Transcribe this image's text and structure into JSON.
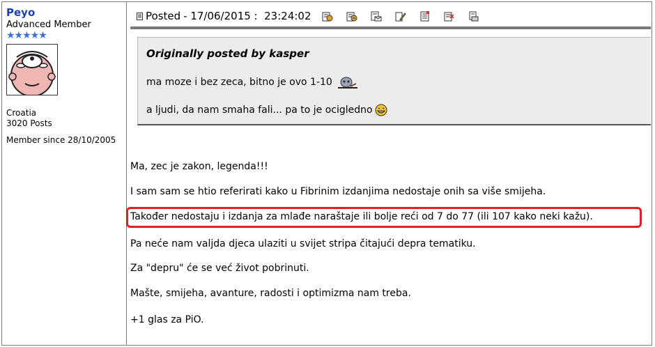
{
  "user": {
    "username": "Peyo",
    "rank": "Advanced Member",
    "stars": "★★★★★",
    "country": "Croatia",
    "posts": "3020 Posts",
    "member_since": "Member since 28/10/2005"
  },
  "header": {
    "posted_label": "Posted",
    "posted_date": "- 17/06/2015 :  23:24:02",
    "tools": [
      "reply-quote-icon",
      "edit-icon",
      "email-icon",
      "pencil-icon",
      "notes-icon",
      "delete-icon",
      "ip-icon"
    ]
  },
  "quote": {
    "heading": "Originally posted by kasper",
    "line1": "ma moze i bez zeca, bitno je ovo 1-10",
    "line2": "a ljudi, da nam smaha fali... pa to je ocigledno"
  },
  "body": {
    "lines": [
      "Ma, zec je zakon, legenda!!!",
      "I sam sam se htio referirati kako u Fibrinim izdanjima nedostaje onih sa više smijeha.",
      "Također nedostaju i izdanja za mlađe naraštaje ili bolje reći od 7 do 77 (ili 107 kako neki kažu).",
      "Pa neće nam valjda djeca ulaziti u svijet stripa čitajući depra tematiku.",
      "Za \"depru\" će se već život pobrinuti.",
      "Mašte, smijeha, avanture, radosti i optimizma nam treba.",
      "+1 glas za PiO."
    ]
  },
  "colors": {
    "username": "#1a3fb0",
    "highlight_border": "#e02020",
    "quote_bg": "#ececec"
  }
}
